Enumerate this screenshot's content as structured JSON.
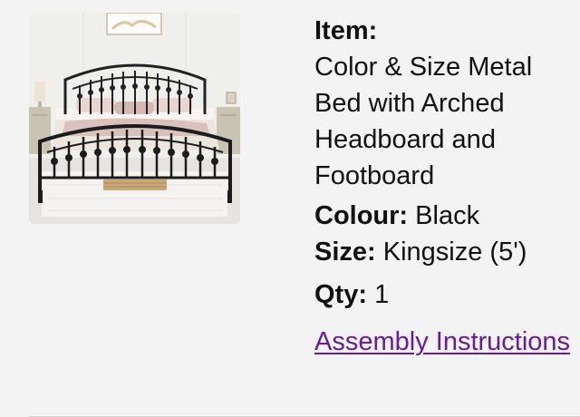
{
  "product": {
    "image_alt": "Metal bed with arched headboard and footboard in a bedroom",
    "item_label": "Item:",
    "item_name": "Color & Size Metal Bed with Arched Headboard and Footboard",
    "colour_label": "Colour:",
    "colour_value": "Black",
    "size_label": "Size:",
    "size_value": "Kingsize (5')",
    "qty_label": "Qty:",
    "qty_value": "1",
    "assembly_link_label": "Assembly Instructions"
  },
  "colors": {
    "link": "#6a1b9a",
    "background": "#f3f3f3",
    "text": "#111111"
  }
}
